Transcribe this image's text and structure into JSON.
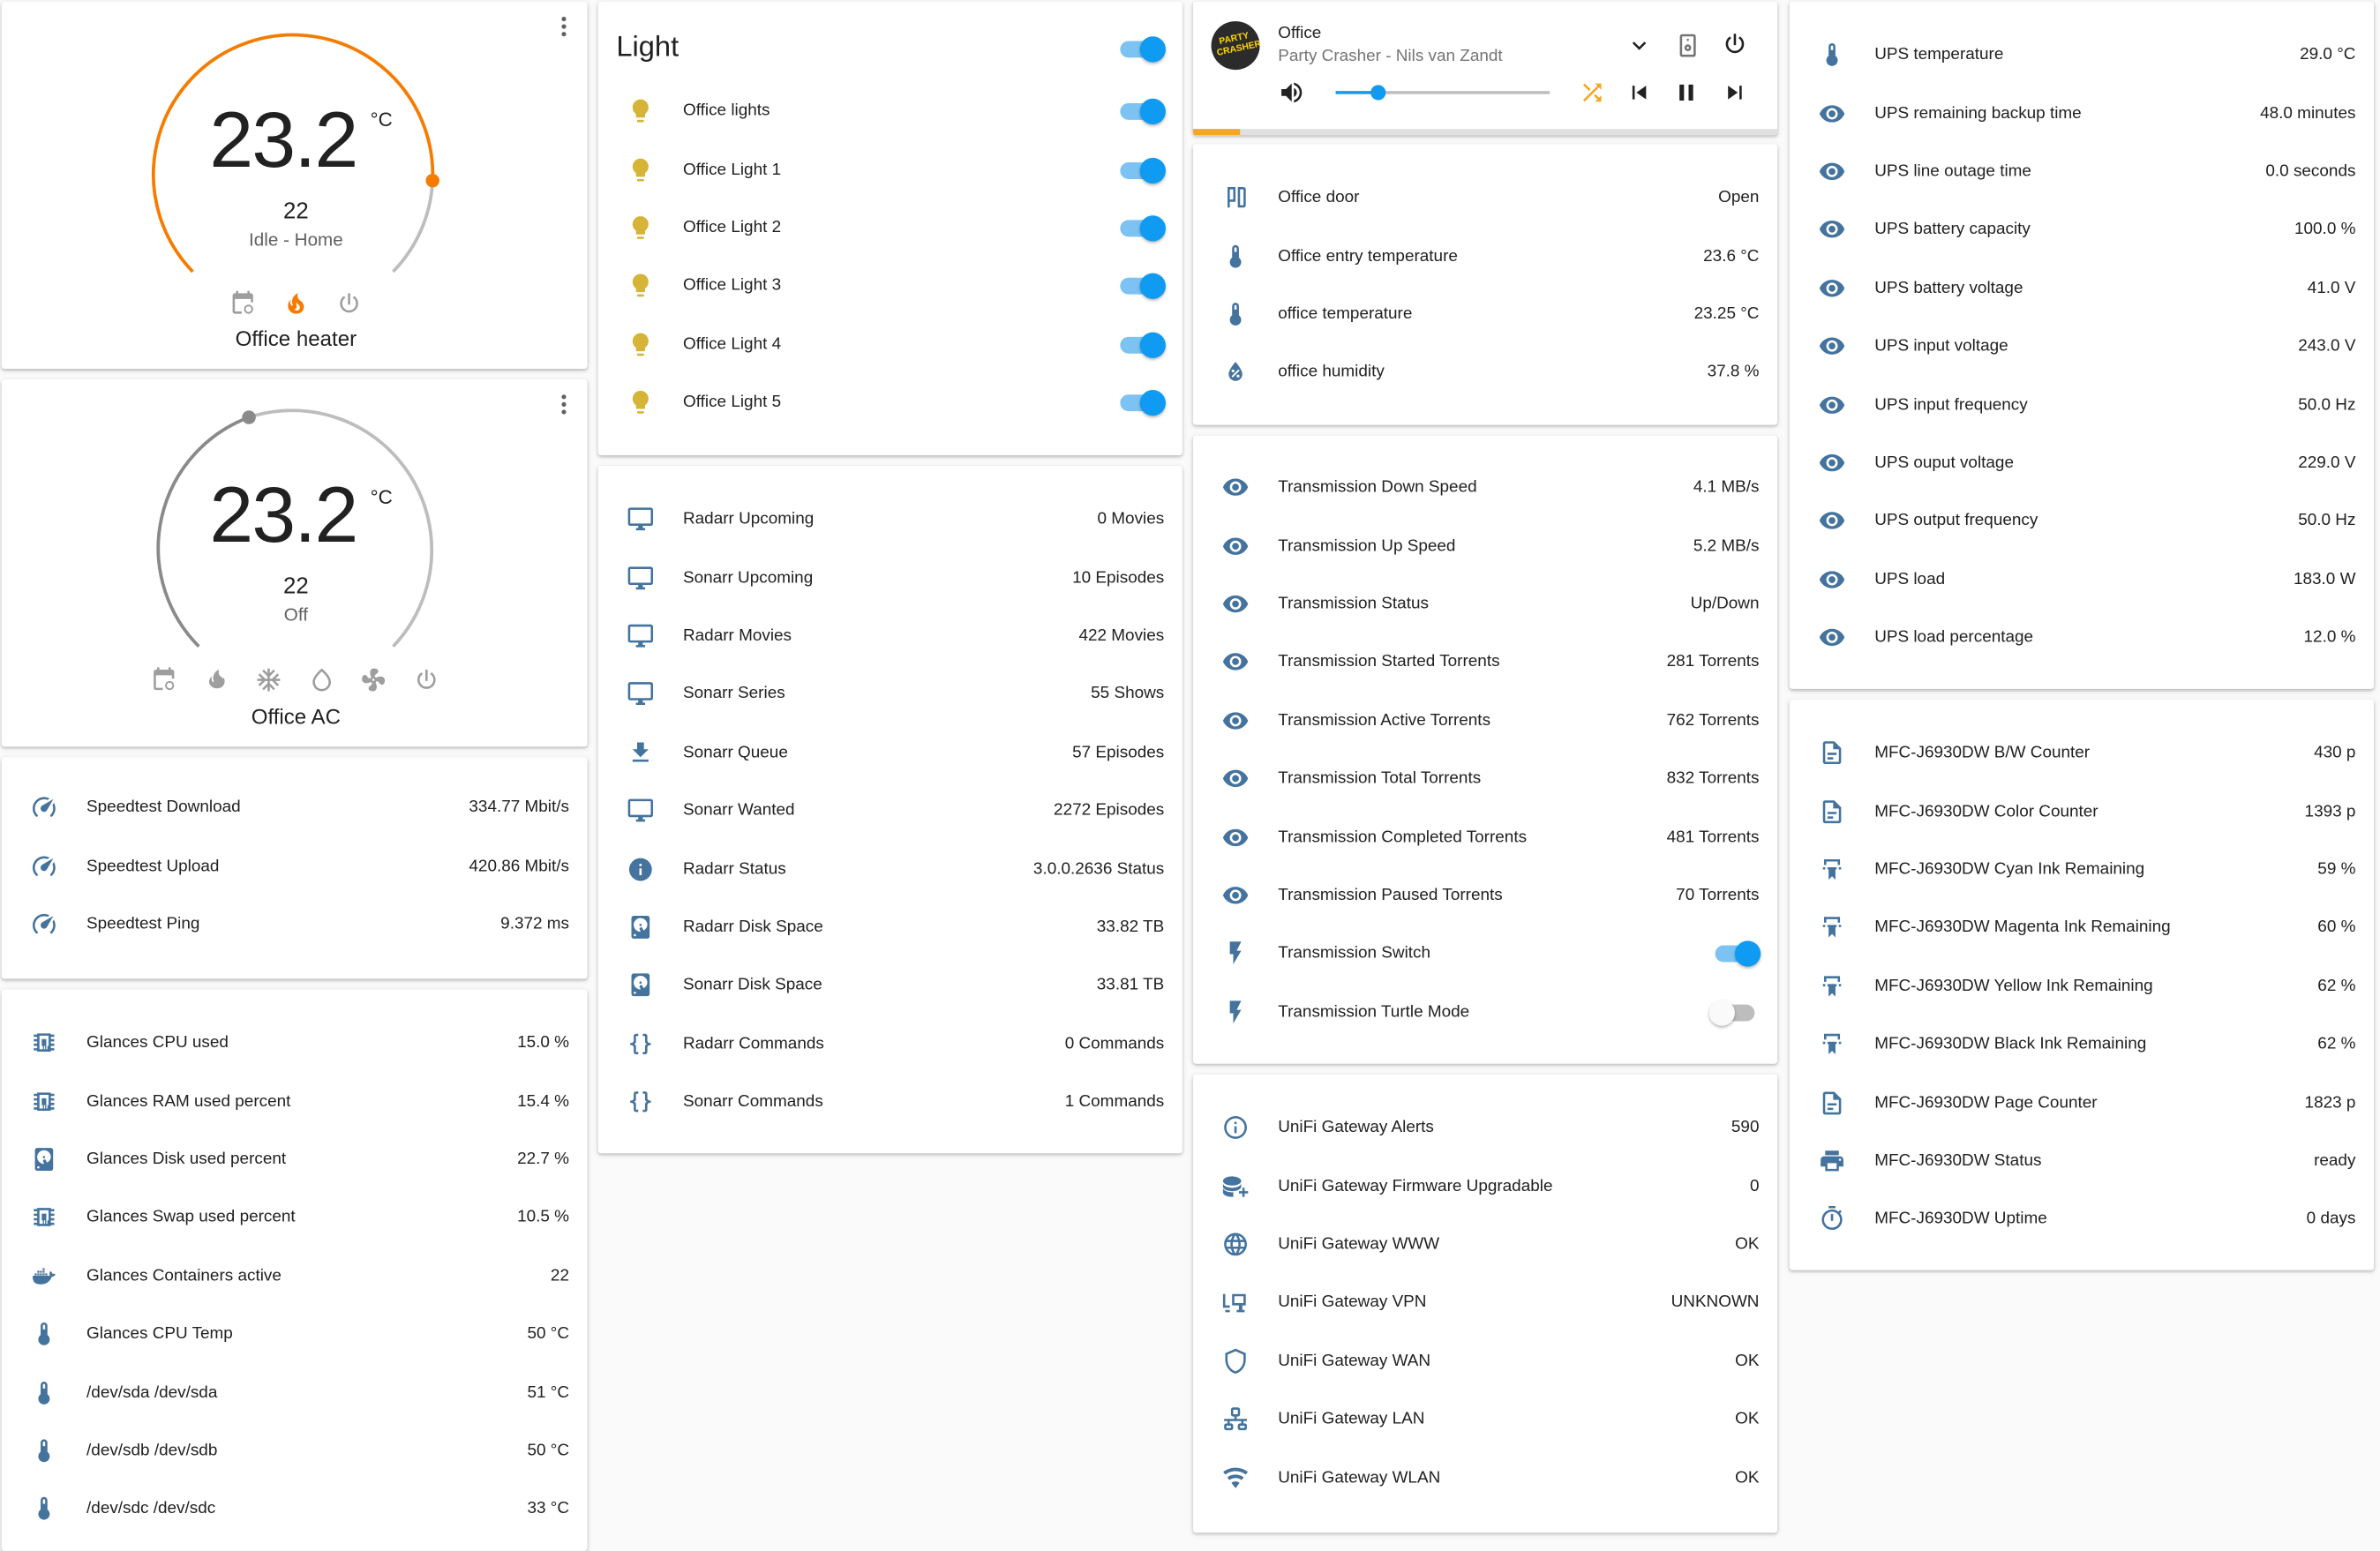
{
  "heater": {
    "temp": "23.2",
    "unit": "°C",
    "target": "22",
    "status": "Idle - Home",
    "name": "Office heater"
  },
  "ac": {
    "temp": "23.2",
    "unit": "°C",
    "target": "22",
    "status": "Off",
    "name": "Office AC"
  },
  "speedtest": [
    {
      "icon": "speedometer-icon",
      "name": "Speedtest Download",
      "value": "334.77 Mbit/s"
    },
    {
      "icon": "speedometer-icon",
      "name": "Speedtest Upload",
      "value": "420.86 Mbit/s"
    },
    {
      "icon": "speedometer-icon",
      "name": "Speedtest Ping",
      "value": "9.372 ms"
    }
  ],
  "glances": [
    {
      "icon": "chip-icon",
      "name": "Glances CPU used",
      "value": "15.0 %"
    },
    {
      "icon": "chip-icon",
      "name": "Glances RAM used percent",
      "value": "15.4 %"
    },
    {
      "icon": "harddisk-icon",
      "name": "Glances Disk used percent",
      "value": "22.7 %"
    },
    {
      "icon": "chip-icon",
      "name": "Glances Swap used percent",
      "value": "10.5 %"
    },
    {
      "icon": "docker-icon",
      "name": "Glances Containers active",
      "value": "22"
    },
    {
      "icon": "thermometer-icon",
      "name": "Glances CPU Temp",
      "value": "50 °C"
    },
    {
      "icon": "thermometer-icon",
      "name": "/dev/sda /dev/sda",
      "value": "51 °C"
    },
    {
      "icon": "thermometer-icon",
      "name": "/dev/sdb /dev/sdb",
      "value": "50 °C"
    },
    {
      "icon": "thermometer-icon",
      "name": "/dev/sdc /dev/sdc",
      "value": "33 °C"
    }
  ],
  "light": {
    "title": "Light",
    "items": [
      {
        "name": "Office lights"
      },
      {
        "name": "Office Light 1"
      },
      {
        "name": "Office Light 2"
      },
      {
        "name": "Office Light 3"
      },
      {
        "name": "Office Light 4"
      },
      {
        "name": "Office Light 5"
      }
    ]
  },
  "media_server": [
    {
      "icon": "monitor-icon",
      "name": "Radarr Upcoming",
      "value": "0 Movies"
    },
    {
      "icon": "monitor-icon",
      "name": "Sonarr Upcoming",
      "value": "10 Episodes"
    },
    {
      "icon": "monitor-icon",
      "name": "Radarr Movies",
      "value": "422 Movies"
    },
    {
      "icon": "monitor-icon",
      "name": "Sonarr Series",
      "value": "55 Shows"
    },
    {
      "icon": "download-icon",
      "name": "Sonarr Queue",
      "value": "57 Episodes"
    },
    {
      "icon": "monitor-icon",
      "name": "Sonarr Wanted",
      "value": "2272 Episodes"
    },
    {
      "icon": "info-icon",
      "name": "Radarr Status",
      "value": "3.0.0.2636 Status"
    },
    {
      "icon": "harddisk-icon",
      "name": "Radarr Disk Space",
      "value": "33.82 TB"
    },
    {
      "icon": "harddisk-icon",
      "name": "Sonarr Disk Space",
      "value": "33.81 TB"
    },
    {
      "icon": "braces-icon",
      "name": "Radarr Commands",
      "value": "0 Commands"
    },
    {
      "icon": "braces-icon",
      "name": "Sonarr Commands",
      "value": "1 Commands"
    }
  ],
  "media_player": {
    "room": "Office",
    "track": "Party Crasher - Nils van Zandt",
    "album_art_text": "PARTY CRASHER",
    "volume_fraction": 0.2,
    "progress_fraction": 0.08
  },
  "office_sensors": [
    {
      "icon": "door-icon",
      "name": "Office door",
      "value": "Open"
    },
    {
      "icon": "thermometer-icon",
      "name": "Office entry temperature",
      "value": "23.6 °C"
    },
    {
      "icon": "thermometer-icon",
      "name": "office temperature",
      "value": "23.25 °C"
    },
    {
      "icon": "water-percent-icon",
      "name": "office humidity",
      "value": "37.8 %"
    }
  ],
  "transmission": [
    {
      "icon": "eye-icon",
      "name": "Transmission Down Speed",
      "value": "4.1 MB/s"
    },
    {
      "icon": "eye-icon",
      "name": "Transmission Up Speed",
      "value": "5.2 MB/s"
    },
    {
      "icon": "eye-icon",
      "name": "Transmission Status",
      "value": "Up/Down"
    },
    {
      "icon": "eye-icon",
      "name": "Transmission Started Torrents",
      "value": "281 Torrents"
    },
    {
      "icon": "eye-icon",
      "name": "Transmission Active Torrents",
      "value": "762 Torrents"
    },
    {
      "icon": "eye-icon",
      "name": "Transmission Total Torrents",
      "value": "832 Torrents"
    },
    {
      "icon": "eye-icon",
      "name": "Transmission Completed Torrents",
      "value": "481 Torrents"
    },
    {
      "icon": "eye-icon",
      "name": "Transmission Paused Torrents",
      "value": "70 Torrents"
    },
    {
      "icon": "flash-icon",
      "name": "Transmission Switch",
      "toggle": true,
      "on": true
    },
    {
      "icon": "flash-icon",
      "name": "Transmission Turtle Mode",
      "toggle": true,
      "on": false
    }
  ],
  "unifi": [
    {
      "icon": "info-outline-icon",
      "name": "UniFi Gateway Alerts",
      "value": "590"
    },
    {
      "icon": "database-plus-icon",
      "name": "UniFi Gateway Firmware Upgradable",
      "value": "0"
    },
    {
      "icon": "web-icon",
      "name": "UniFi Gateway WWW",
      "value": "OK"
    },
    {
      "icon": "vpn-icon",
      "name": "UniFi Gateway VPN",
      "value": "UNKNOWN"
    },
    {
      "icon": "shield-icon",
      "name": "UniFi Gateway WAN",
      "value": "OK"
    },
    {
      "icon": "lan-icon",
      "name": "UniFi Gateway LAN",
      "value": "OK"
    },
    {
      "icon": "wifi-icon",
      "name": "UniFi Gateway WLAN",
      "value": "OK"
    }
  ],
  "ups": [
    {
      "icon": "thermometer-icon",
      "name": "UPS temperature",
      "value": "29.0 °C"
    },
    {
      "icon": "eye-icon",
      "name": "UPS remaining backup time",
      "value": "48.0 minutes"
    },
    {
      "icon": "eye-icon",
      "name": "UPS line outage time",
      "value": "0.0 seconds"
    },
    {
      "icon": "eye-icon",
      "name": "UPS battery capacity",
      "value": "100.0 %"
    },
    {
      "icon": "eye-icon",
      "name": "UPS battery voltage",
      "value": "41.0 V"
    },
    {
      "icon": "eye-icon",
      "name": "UPS input voltage",
      "value": "243.0 V"
    },
    {
      "icon": "eye-icon",
      "name": "UPS input frequency",
      "value": "50.0 Hz"
    },
    {
      "icon": "eye-icon",
      "name": "UPS ouput voltage",
      "value": "229.0 V"
    },
    {
      "icon": "eye-icon",
      "name": "UPS output frequency",
      "value": "50.0 Hz"
    },
    {
      "icon": "eye-icon",
      "name": "UPS load",
      "value": "183.0 W"
    },
    {
      "icon": "eye-icon",
      "name": "UPS load percentage",
      "value": "12.0 %"
    }
  ],
  "printer": [
    {
      "icon": "file-icon",
      "name": "MFC-J6930DW B/W Counter",
      "value": "430 p"
    },
    {
      "icon": "file-icon",
      "name": "MFC-J6930DW Color Counter",
      "value": "1393 p"
    },
    {
      "icon": "ink-icon",
      "name": "MFC-J6930DW Cyan Ink Remaining",
      "value": "59 %"
    },
    {
      "icon": "ink-icon",
      "name": "MFC-J6930DW Magenta Ink Remaining",
      "value": "60 %"
    },
    {
      "icon": "ink-icon",
      "name": "MFC-J6930DW Yellow Ink Remaining",
      "value": "62 %"
    },
    {
      "icon": "ink-icon",
      "name": "MFC-J6930DW Black Ink Remaining",
      "value": "62 %"
    },
    {
      "icon": "file-icon",
      "name": "MFC-J6930DW Page Counter",
      "value": "1823 p"
    },
    {
      "icon": "printer-icon",
      "name": "MFC-J6930DW Status",
      "value": "ready"
    },
    {
      "icon": "timer-icon",
      "name": "MFC-J6930DW Uptime",
      "value": "0 days"
    }
  ],
  "colors": {
    "accent": "#0f9bf2",
    "icon": "#44739e",
    "heat": "#f57c00",
    "bulb": "#d6b437"
  }
}
